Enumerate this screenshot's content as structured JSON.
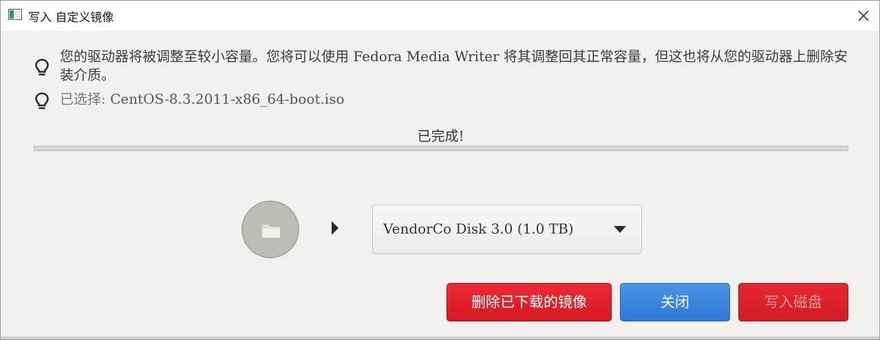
{
  "window": {
    "title": "写入 自定义镜像"
  },
  "info": {
    "message": "您的驱动器将被调整至较小容量。您将可以使用 Fedora Media Writer 将其调整回其正常容量，但这也将从您的驱动器上删除安装介质。",
    "selected_label": "已选择: ",
    "selected_file": "CentOS-8.3.2011-x86_64-boot.iso"
  },
  "progress": {
    "status": "已完成!",
    "value": 1.0
  },
  "drive": {
    "selected": "VendorCo Disk 3.0 (1.0 TB)"
  },
  "buttons": {
    "delete_label": "删除已下载的镜像",
    "close_label": "关闭",
    "write_label": "写入磁盘"
  },
  "colors": {
    "delete": "#de1f28",
    "close": "#3b84dc",
    "write": "#dc2128"
  }
}
